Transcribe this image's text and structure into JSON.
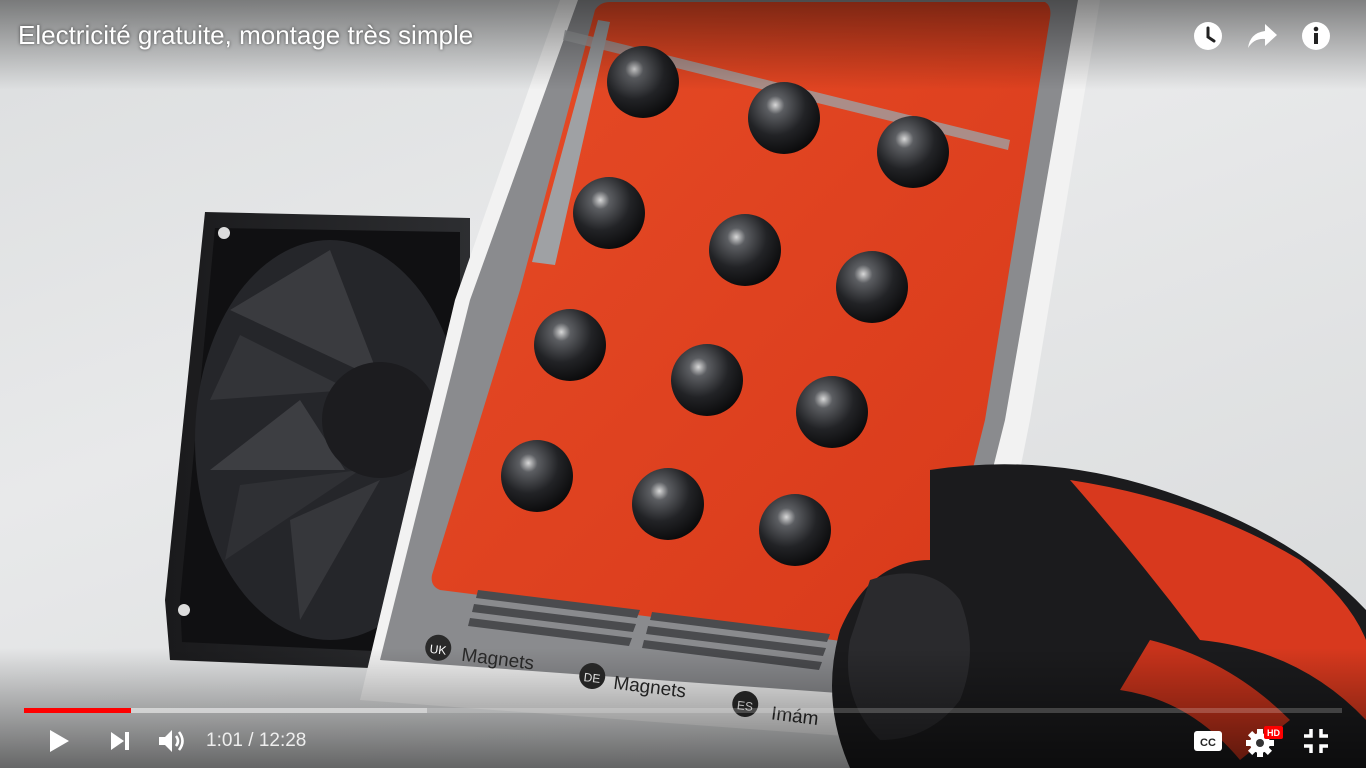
{
  "video": {
    "title": "Electricité gratuite, montage très simple",
    "package_labels": [
      {
        "lang": "UK",
        "text": "Magnets"
      },
      {
        "lang": "DE",
        "text": "Magnets"
      },
      {
        "lang": "ES",
        "text": "Imám"
      }
    ]
  },
  "top_icons": [
    "watch-later-icon",
    "share-icon",
    "info-icon"
  ],
  "controls": {
    "current_time": "1:01",
    "separator": " / ",
    "duration": "12:28",
    "progress_played_fraction": 0.081,
    "progress_loaded_fraction": 0.306,
    "hd_badge": "HD",
    "icons": [
      "play-icon",
      "next-icon",
      "volume-icon",
      "captions-icon",
      "settings-icon",
      "fullscreen-exit-icon"
    ]
  },
  "colors": {
    "progress_played": "#ff0000",
    "package_red": "#e2401e",
    "control_icon": "#ffffff"
  }
}
